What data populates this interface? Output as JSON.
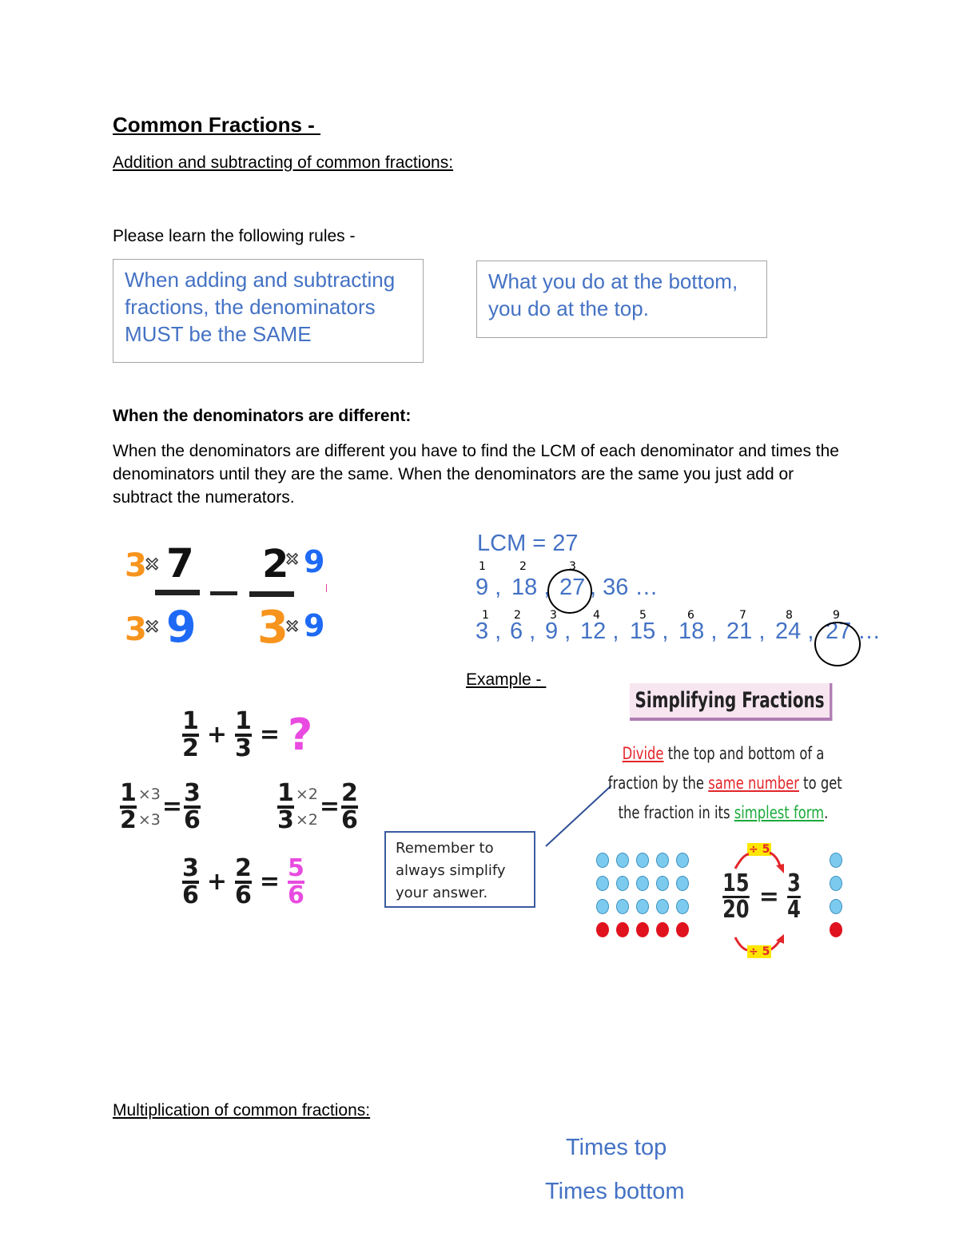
{
  "title": "Common Fractions - ",
  "subtitle": "Addition and subtracting of common fractions:",
  "intro": "Please learn the following rules -",
  "rules": [
    "When adding and subtracting fractions, the denominators MUST be the SAME",
    "What you do at the bottom, you do at the top."
  ],
  "different_heading": "When the denominators are different:",
  "different_text": "When the denominators are different you have to find the LCM of each denominator and times the denominators until they are the same. When the denominators are the same you just add or subtract the numerators.",
  "subtraction_example": {
    "left": {
      "numerator": "7",
      "denominator": "9",
      "multiplier": "3"
    },
    "operator": "–",
    "right": {
      "numerator": "2",
      "denominator": "3",
      "multiplier": "9"
    },
    "times_symbol": "×"
  },
  "lcm": {
    "label": "LCM = 27",
    "seq9": {
      "indices": [
        "1",
        "2",
        "3"
      ],
      "values": [
        "9 ,",
        "18 ,",
        "27",
        ", 36 …"
      ]
    },
    "seq3": {
      "indices": [
        "1",
        "2",
        "3",
        "4",
        "5",
        "6",
        "7",
        "8",
        "9"
      ],
      "values": [
        "3 ,",
        "6 ,",
        "9 ,",
        "12 ,",
        "15 ,",
        "18 ,",
        "21 ,",
        "24 ,",
        "27",
        "…"
      ]
    }
  },
  "example_label": "Example - ",
  "addition_example": {
    "problem": {
      "a_num": "1",
      "a_den": "2",
      "plus": "+",
      "b_num": "1",
      "b_den": "3",
      "equals": "=",
      "result": "?"
    },
    "step1": {
      "num": "1",
      "den": "2",
      "mul_top": "×3",
      "mul_bot": "×3",
      "equals": "=",
      "res_num": "3",
      "res_den": "6"
    },
    "step2": {
      "num": "1",
      "den": "3",
      "mul_top": "×2",
      "mul_bot": "×2",
      "equals": "=",
      "res_num": "2",
      "res_den": "6"
    },
    "final": {
      "a_num": "3",
      "a_den": "6",
      "plus": "+",
      "b_num": "2",
      "b_den": "6",
      "equals": "=",
      "res_num": "5",
      "res_den": "6"
    }
  },
  "callout": "Remember to always simplify your answer.",
  "simplifying": {
    "title": "Simplifying Fractions",
    "line1": {
      "red": "Divide",
      "rest": " the top and bottom of a"
    },
    "line2": {
      "start": "fraction by the ",
      "red": "same number",
      "end": " to get"
    },
    "line3": {
      "start": "the fraction in its ",
      "green": "simplest form",
      "end": "."
    },
    "divide_tag": "÷ 5",
    "fraction": {
      "num": "15",
      "den": "20",
      "equals": "=",
      "res_num": "3",
      "res_den": "4"
    },
    "dots_left": {
      "rows": 4,
      "cols": 5,
      "shaded_rows": 1
    },
    "dots_right": {
      "rows": 4,
      "cols": 1,
      "shaded_rows": 1
    },
    "colors": {
      "blue": "#7ccbef",
      "red": "#e0121e"
    }
  },
  "multiplication_heading": "Multiplication of common fractions:",
  "multiplication_rules": [
    "Times top",
    "Times bottom"
  ]
}
